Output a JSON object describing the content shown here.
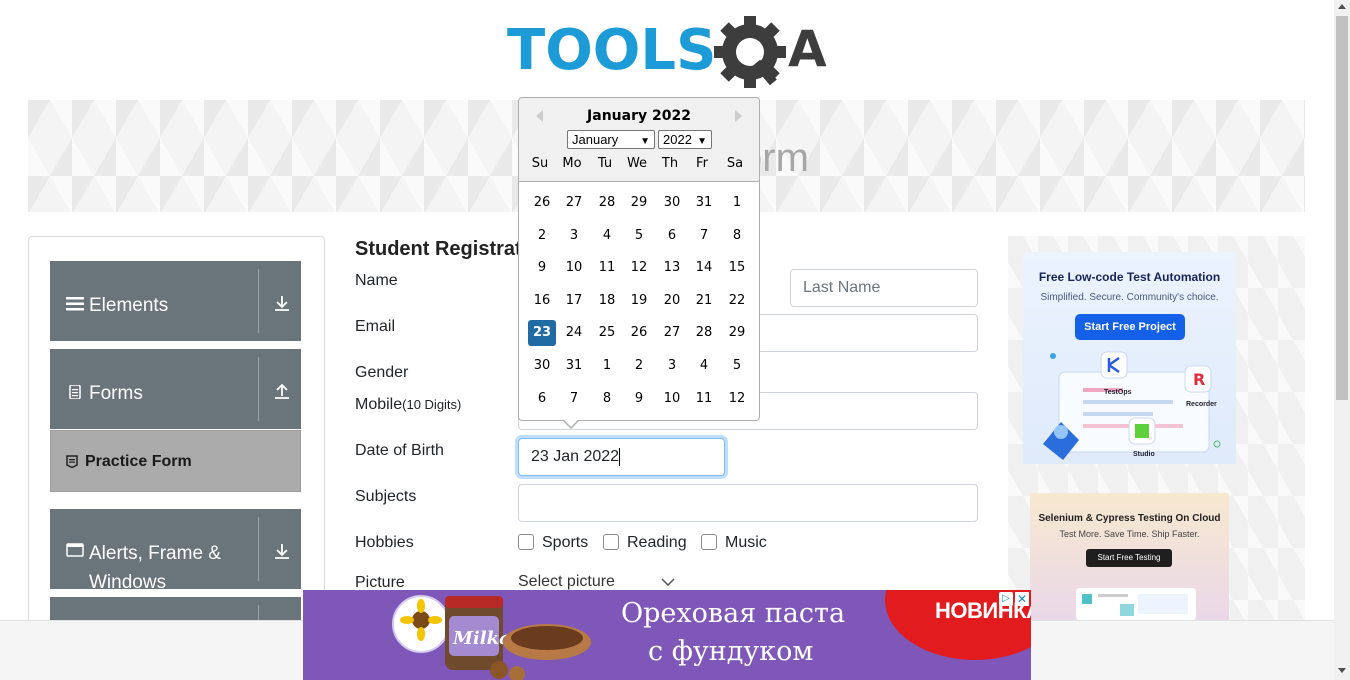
{
  "logo": {
    "text": "TOOLS",
    "suffix": "A"
  },
  "banner": {
    "title": "Practice Form"
  },
  "sidebar": {
    "groups": [
      {
        "label": "Elements",
        "icon": "hamburger-icon",
        "arrow": "download-arrow-icon"
      },
      {
        "label": "Forms",
        "icon": "document-icon",
        "arrow": "upload-arrow-icon"
      },
      {
        "label": "Alerts, Frame & Windows",
        "icon": "window-icon",
        "arrow": "download-arrow-icon"
      }
    ],
    "active_item": {
      "label": "Practice Form",
      "icon": "form-icon"
    }
  },
  "form": {
    "title": "Student Registration Form",
    "name_label": "Name",
    "last_name_placeholder": "Last Name",
    "email_label": "Email",
    "gender_label": "Gender",
    "mobile_label": "Mobile",
    "mobile_hint": "(10 Digits)",
    "dob_label": "Date of Birth",
    "dob_value": "23 Jan 2022",
    "subjects_label": "Subjects",
    "hobbies_label": "Hobbies",
    "hobbies": [
      "Sports",
      "Reading",
      "Music"
    ],
    "picture_label": "Picture",
    "picture_select": "Select picture"
  },
  "datepicker": {
    "title": "January 2022",
    "month_select": "January",
    "year_select": "2022",
    "weekdays": [
      "Su",
      "Mo",
      "Tu",
      "We",
      "Th",
      "Fr",
      "Sa"
    ],
    "weeks": [
      [
        "26",
        "27",
        "28",
        "29",
        "30",
        "31",
        "1"
      ],
      [
        "2",
        "3",
        "4",
        "5",
        "6",
        "7",
        "8"
      ],
      [
        "9",
        "10",
        "11",
        "12",
        "13",
        "14",
        "15"
      ],
      [
        "16",
        "17",
        "18",
        "19",
        "20",
        "21",
        "22"
      ],
      [
        "23",
        "24",
        "25",
        "26",
        "27",
        "28",
        "29"
      ],
      [
        "30",
        "31",
        "1",
        "2",
        "3",
        "4",
        "5"
      ],
      [
        "6",
        "7",
        "8",
        "9",
        "10",
        "11",
        "12"
      ]
    ],
    "selected_day": "23",
    "selected_color": "#216ba5"
  },
  "ads": {
    "ad1": {
      "title": "Free Low-code Test Automation",
      "subtitle": "Simplified. Secure. Community's choice.",
      "button": "Start Free Project",
      "tags": [
        "TestOps",
        "Recorder",
        "Studio"
      ]
    },
    "ad2": {
      "title": "Selenium & Cypress Testing On Cloud",
      "subtitle": "Test More. Save Time. Ship Faster.",
      "button": "Start Free Testing"
    },
    "bottom": {
      "line1": "Ореховая паста",
      "line2": "с фундуком",
      "badge": "НОВИНКА",
      "brand": "Milka"
    }
  },
  "colors": {
    "brand_blue": "#1d9bd7",
    "brand_dark": "#3d3d3d",
    "sidebar_group": "#6a747b",
    "sidebar_active": "#ababab",
    "ad_purple": "#7f57b8"
  }
}
